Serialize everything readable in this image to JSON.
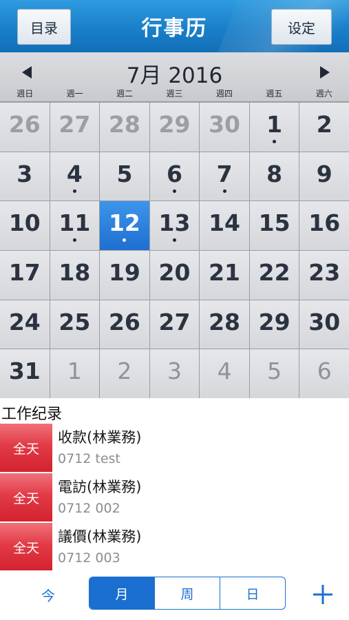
{
  "header": {
    "title": "行事历",
    "menu_label": "目录",
    "settings_label": "设定"
  },
  "month_bar": {
    "label": "7月 2016",
    "weekdays": [
      "週日",
      "週一",
      "週二",
      "週三",
      "週四",
      "週五",
      "週六"
    ]
  },
  "calendar": {
    "selected_day": 12,
    "days": [
      {
        "n": "26",
        "t": "prev",
        "dot": false
      },
      {
        "n": "27",
        "t": "prev",
        "dot": false
      },
      {
        "n": "28",
        "t": "prev",
        "dot": false
      },
      {
        "n": "29",
        "t": "prev",
        "dot": false
      },
      {
        "n": "30",
        "t": "prev",
        "dot": false
      },
      {
        "n": "1",
        "t": "cur",
        "dot": true
      },
      {
        "n": "2",
        "t": "cur",
        "dot": false
      },
      {
        "n": "3",
        "t": "cur",
        "dot": false
      },
      {
        "n": "4",
        "t": "cur",
        "dot": true
      },
      {
        "n": "5",
        "t": "cur",
        "dot": false
      },
      {
        "n": "6",
        "t": "cur",
        "dot": true
      },
      {
        "n": "7",
        "t": "cur",
        "dot": true
      },
      {
        "n": "8",
        "t": "cur",
        "dot": false
      },
      {
        "n": "9",
        "t": "cur",
        "dot": false
      },
      {
        "n": "10",
        "t": "cur",
        "dot": false
      },
      {
        "n": "11",
        "t": "cur",
        "dot": true
      },
      {
        "n": "12",
        "t": "sel",
        "dot": true
      },
      {
        "n": "13",
        "t": "cur",
        "dot": true
      },
      {
        "n": "14",
        "t": "cur",
        "dot": false
      },
      {
        "n": "15",
        "t": "cur",
        "dot": false
      },
      {
        "n": "16",
        "t": "cur",
        "dot": false
      },
      {
        "n": "17",
        "t": "cur",
        "dot": false
      },
      {
        "n": "18",
        "t": "cur",
        "dot": false
      },
      {
        "n": "19",
        "t": "cur",
        "dot": false
      },
      {
        "n": "20",
        "t": "cur",
        "dot": false
      },
      {
        "n": "21",
        "t": "cur",
        "dot": false
      },
      {
        "n": "22",
        "t": "cur",
        "dot": false
      },
      {
        "n": "23",
        "t": "cur",
        "dot": false
      },
      {
        "n": "24",
        "t": "cur",
        "dot": false
      },
      {
        "n": "25",
        "t": "cur",
        "dot": false
      },
      {
        "n": "26",
        "t": "cur",
        "dot": false
      },
      {
        "n": "27",
        "t": "cur",
        "dot": false
      },
      {
        "n": "28",
        "t": "cur",
        "dot": false
      },
      {
        "n": "29",
        "t": "cur",
        "dot": false
      },
      {
        "n": "30",
        "t": "cur",
        "dot": false
      },
      {
        "n": "31",
        "t": "cur",
        "dot": false
      },
      {
        "n": "1",
        "t": "next",
        "dot": false
      },
      {
        "n": "2",
        "t": "next",
        "dot": false
      },
      {
        "n": "3",
        "t": "next",
        "dot": false
      },
      {
        "n": "4",
        "t": "next",
        "dot": false
      },
      {
        "n": "5",
        "t": "next",
        "dot": false
      },
      {
        "n": "6",
        "t": "next",
        "dot": false
      }
    ]
  },
  "records": {
    "title": "工作纪录",
    "items": [
      {
        "badge": "全天",
        "title": "收款(林業務)",
        "subtitle": "0712 test"
      },
      {
        "badge": "全天",
        "title": "電訪(林業務)",
        "subtitle": "0712 002"
      },
      {
        "badge": "全天",
        "title": "議價(林業務)",
        "subtitle": "0712 003"
      }
    ]
  },
  "bottom_bar": {
    "today_label": "今",
    "views": [
      "月",
      "周",
      "日"
    ],
    "active_view": "月"
  },
  "colors": {
    "header_blue": "#1a7fc9",
    "accent_blue": "#1a6fd0",
    "badge_red": "#e23b47",
    "selected_blue": "#2a7fdc"
  }
}
